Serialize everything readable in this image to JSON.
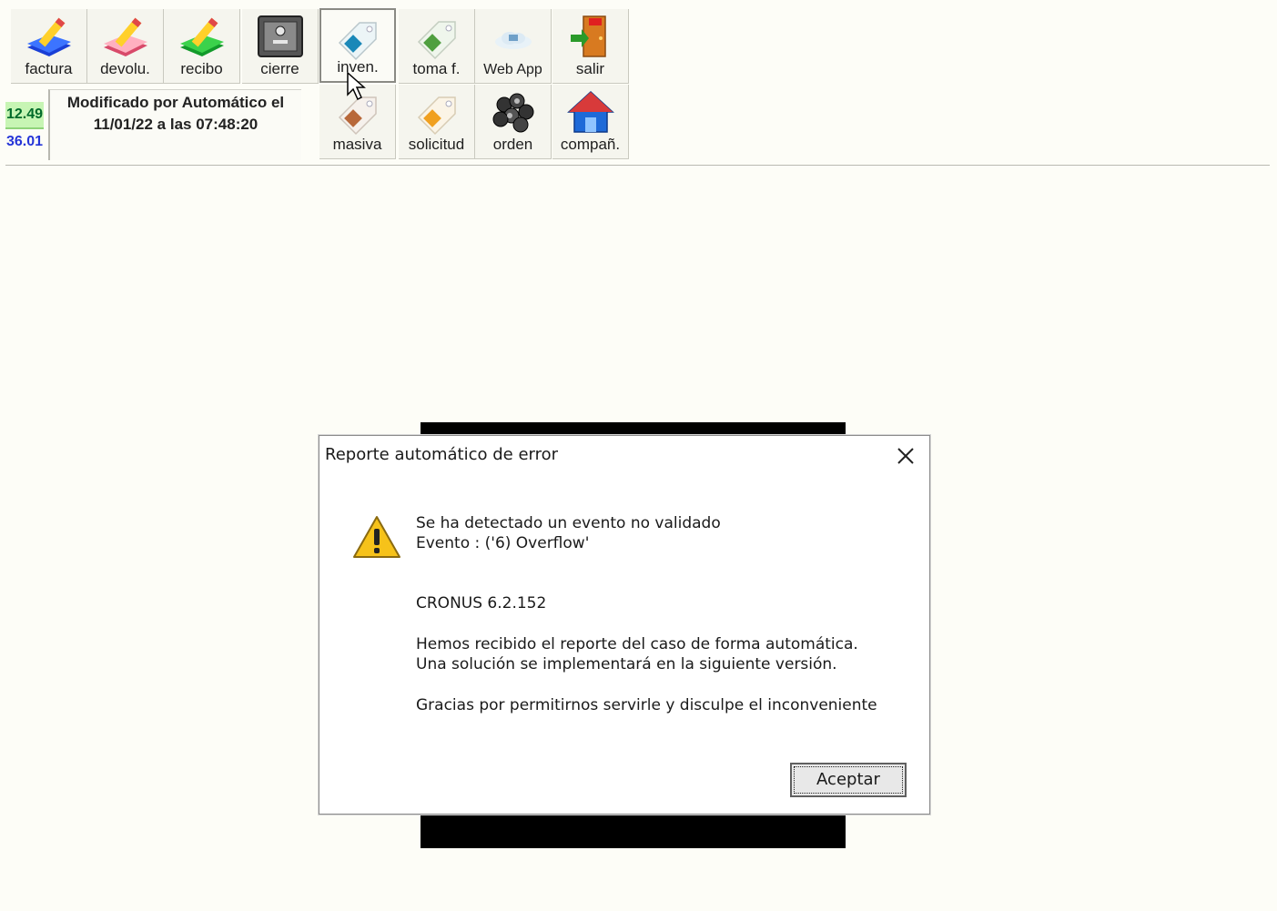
{
  "toolbar": {
    "row1": [
      {
        "label": "factura",
        "icon": "invoice-pencil-blue-icon"
      },
      {
        "label": "devolu.",
        "icon": "return-pencil-pink-icon"
      },
      {
        "label": "recibo",
        "icon": "receipt-pencil-green-icon"
      },
      {
        "label": "cierre",
        "icon": "safe-icon"
      },
      {
        "label": "inven.",
        "icon": "tag-blue-icon"
      },
      {
        "label": "toma f.",
        "icon": "tag-green-icon"
      },
      {
        "label": "Web App",
        "icon": "cloud-icon"
      },
      {
        "label": "salir",
        "icon": "exit-door-icon"
      }
    ],
    "row2": [
      {
        "label": "masiva",
        "icon": "tag-brown-icon"
      },
      {
        "label": "solicitud",
        "icon": "tag-orange-icon"
      },
      {
        "label": "orden",
        "icon": "coins-icon"
      },
      {
        "label": "compañ.",
        "icon": "house-icon"
      }
    ]
  },
  "totals": {
    "value1": "12.49",
    "value2": "36.01"
  },
  "info": {
    "line1": "Modificado por Automático el",
    "line2": "11/01/22 a las 07:48:20"
  },
  "dialog": {
    "title": "Reporte automático de error",
    "line1": "Se ha detectado un evento no validado",
    "line2": "Evento : ('6) Overflow'",
    "version": "CRONUS 6.2.152",
    "line3": "Hemos recibido el reporte del caso de forma automática.",
    "line4": "Una solución se implementará en la siguiente versión.",
    "line5": "Gracias por permitirnos servirle y disculpe el inconveniente",
    "ok_label": "Aceptar"
  },
  "colors": {
    "background": "#fdfdf7",
    "total1_bg": "#c7f5b4",
    "total1_text": "#006b2a",
    "total2_text": "#2535d8"
  }
}
